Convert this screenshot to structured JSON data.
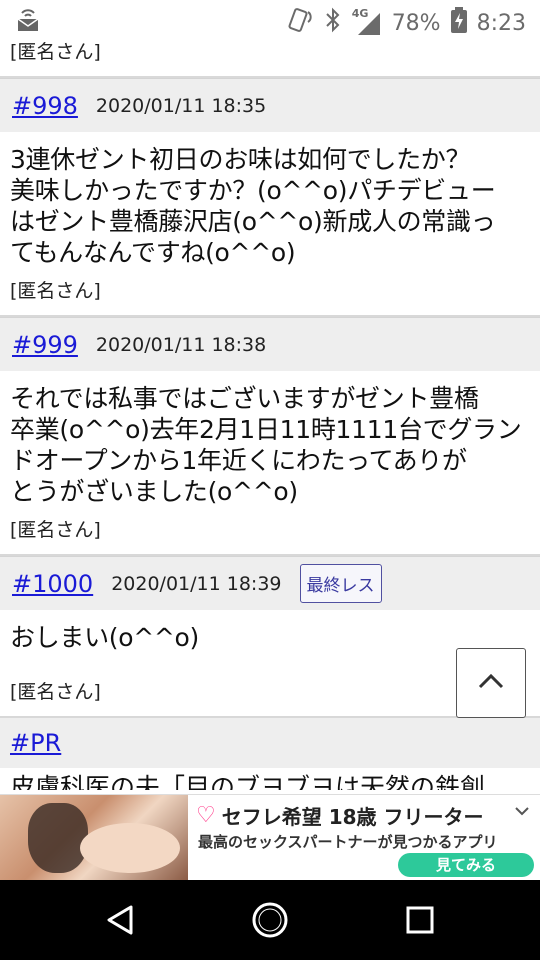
{
  "status_bar": {
    "network": "4G",
    "battery_percent": "78%",
    "time": "8:23"
  },
  "thread": {
    "prev_name": "[匿名さん]",
    "posts": [
      {
        "number": "#998",
        "date": "2020/01/11 18:35",
        "body_lines": [
          "3連休ゼント初日のお味は如何でしたか？",
          "美味しかったですか？(o^^o)パチデビュー",
          "はゼント豊橋藤沢店(o^^o)新成人の常識っ",
          "てもんなんですね(o^^o)"
        ],
        "name": "[匿名さん]"
      },
      {
        "number": "#999",
        "date": "2020/01/11 18:38",
        "body_lines": [
          "それでは私事ではございますがゼント豊橋",
          "卒業(o^^o)去年2月1日11時1111台でグラン",
          "ドオープンから1年近くにわたってありが",
          "とうがざいました(o^^o)"
        ],
        "name": "[匿名さん]"
      },
      {
        "number": "#1000",
        "date": "2020/01/11 18:39",
        "badge": "最終レス",
        "body_lines": [
          "おしまい(o^^o)"
        ],
        "name": "[匿名さん]"
      }
    ],
    "pr": {
      "label": "#PR",
      "text": "皮膚科医の夫「目のブヨブヨは天然の鉄創"
    }
  },
  "ad": {
    "title": "セフレ希望 18歳 フリーター",
    "subtitle": "最高のセックスパートナーが見つかるアプリ",
    "cta": "見てみる"
  },
  "colors": {
    "link": "#1a1ad6",
    "header_bg": "#eeeeee",
    "cta": "#2dc99a"
  }
}
